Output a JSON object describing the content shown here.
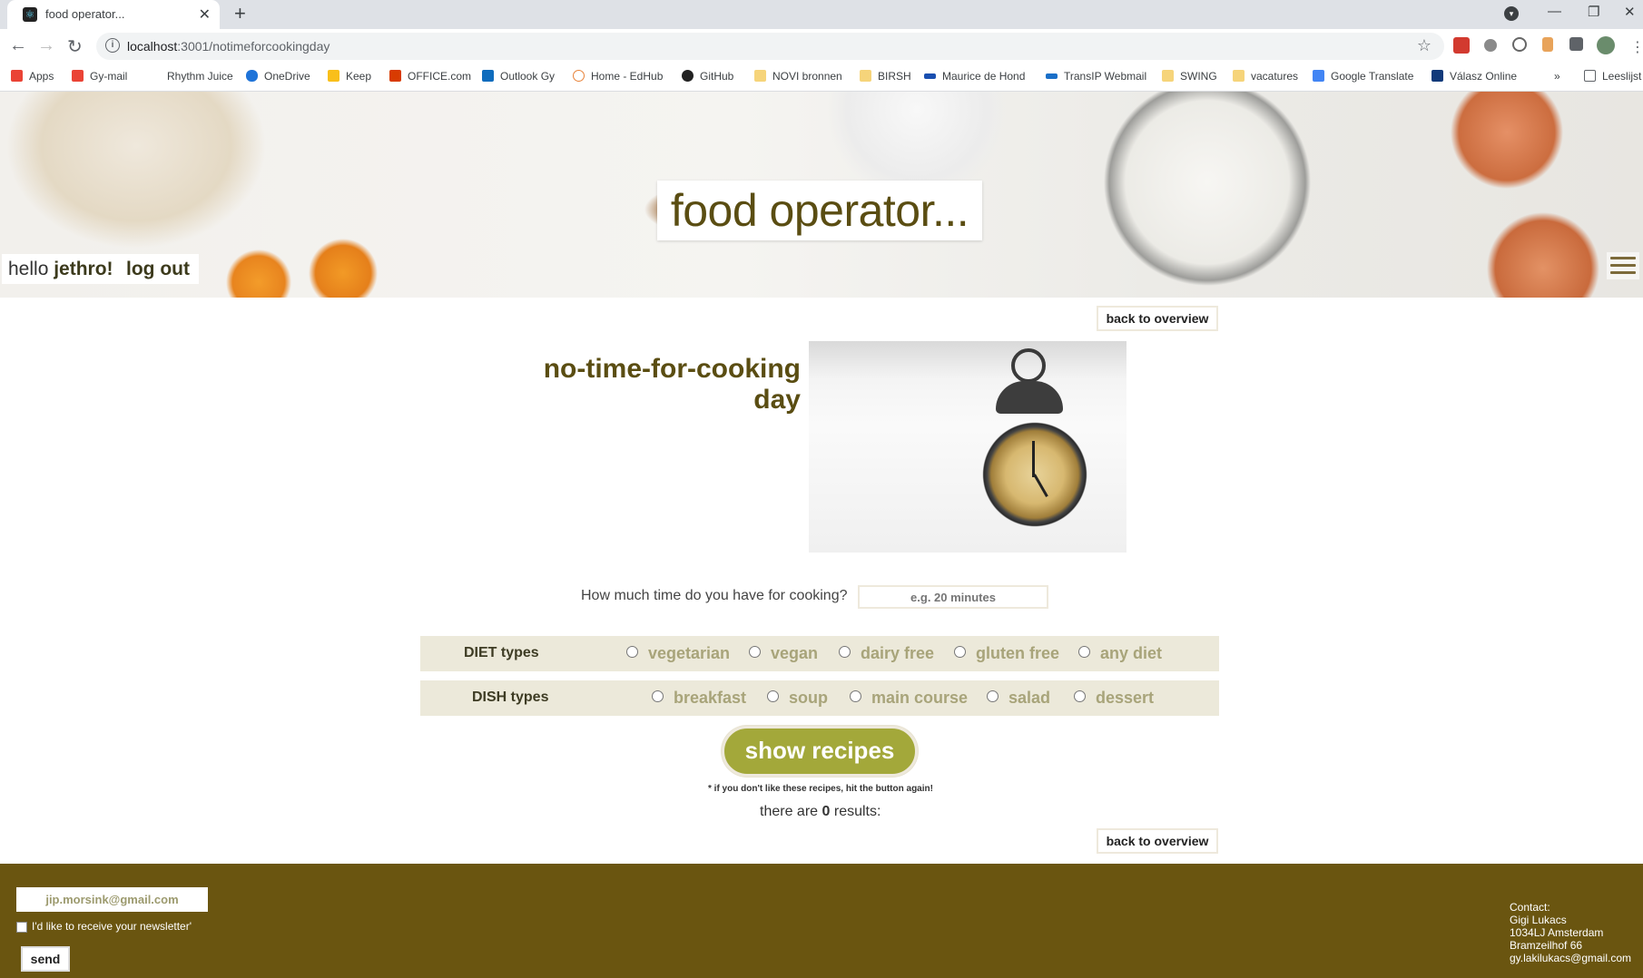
{
  "browser": {
    "tab_title": "food operator...",
    "url_host": "localhost",
    "url_rest": ":3001/notimeforcookingday",
    "bookmarks": [
      "Apps",
      "Gy-mail",
      "Rhythm Juice",
      "OneDrive",
      "Keep",
      "OFFICE.com",
      "Outlook Gy",
      "Home - EdHub",
      "GitHub",
      "NOVI bronnen",
      "BIRSH",
      "Maurice de Hond",
      "TransIP Webmail",
      "SWING",
      "vacatures",
      "Google Translate",
      "Válasz Online",
      "Leeslijst"
    ]
  },
  "header": {
    "site_title": "food operator...",
    "greeting": "hello",
    "username": "jethro!",
    "logout_label": "log out"
  },
  "main": {
    "back_label": "back to overview",
    "page_title": "no-time-for-cooking day",
    "time_question": "How much time do you have for cooking?",
    "time_placeholder": "e.g. 20 minutes",
    "diet_label": "DIET types",
    "diet_options": [
      "vegetarian",
      "vegan",
      "dairy free",
      "gluten free",
      "any diet"
    ],
    "dish_label": "DISH types",
    "dish_options": [
      "breakfast",
      "soup",
      "main course",
      "salad",
      "dessert"
    ],
    "show_label": "show recipes",
    "hint": "* if you don't like these recipes, hit the button again!",
    "results_prefix": "there are",
    "results_count": "0",
    "results_suffix": "results:"
  },
  "footer": {
    "email_value": "jip.morsink@gmail.com",
    "newsletter_label": "I'd like to receive your newsletter'",
    "send_label": "send",
    "contact": [
      "Contact:",
      "Gigi Lukacs",
      "1034LJ Amsterdam",
      "Bramzeilhof 66",
      "gy.lakilukacs@gmail.com"
    ]
  },
  "colors": {
    "brand_dark": "#6a5510",
    "title": "#5a4d12",
    "accent": "#a3a83a",
    "row_bg": "#ece9da"
  }
}
